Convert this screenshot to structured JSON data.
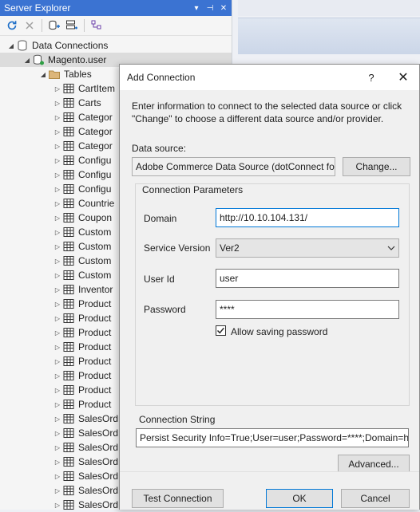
{
  "server_explorer": {
    "title": "Server Explorer",
    "title_buttons": [
      "▾",
      "⊣",
      "✕"
    ],
    "tree": {
      "data_connections": "Data Connections",
      "connection": "Magento.user",
      "tables_folder": "Tables",
      "tables": [
        "CartItem",
        "Carts",
        "Categor",
        "Categor",
        "Categor",
        "Configu",
        "Configu",
        "Configu",
        "Countrie",
        "Coupon",
        "Custom",
        "Custom",
        "Custom",
        "Custom",
        "Inventor",
        "Product",
        "Product",
        "Product",
        "Product",
        "Product",
        "Product",
        "Product",
        "Product",
        "SalesOrd",
        "SalesOrd",
        "SalesOrd",
        "SalesOrd",
        "SalesOrd",
        "SalesOrd",
        "SalesOrd"
      ]
    }
  },
  "dialog": {
    "title": "Add Connection",
    "help_glyph": "?",
    "close_glyph": "✕",
    "intro": "Enter information to connect to the selected data source or click \"Change\" to choose a different data source and/or provider.",
    "data_source_label": "Data source:",
    "data_source_value": "Adobe Commerce Data Source (dotConnect for",
    "change_button": "Change...",
    "group_title": "Connection Parameters",
    "domain_label": "Domain",
    "domain_value": "http://10.10.104.131/",
    "service_version_label": "Service Version",
    "service_version_value": "Ver2",
    "user_id_label": "User Id",
    "user_id_value": "user",
    "password_label": "Password",
    "password_value": "****",
    "allow_saving_label": "Allow saving password",
    "allow_saving_checked": true,
    "conn_string_label": "Connection String",
    "conn_string_value": "Persist Security Info=True;User=user;Password=****;Domain=ht",
    "advanced_button": "Advanced...",
    "test_button": "Test Connection",
    "ok_button": "OK",
    "cancel_button": "Cancel"
  }
}
